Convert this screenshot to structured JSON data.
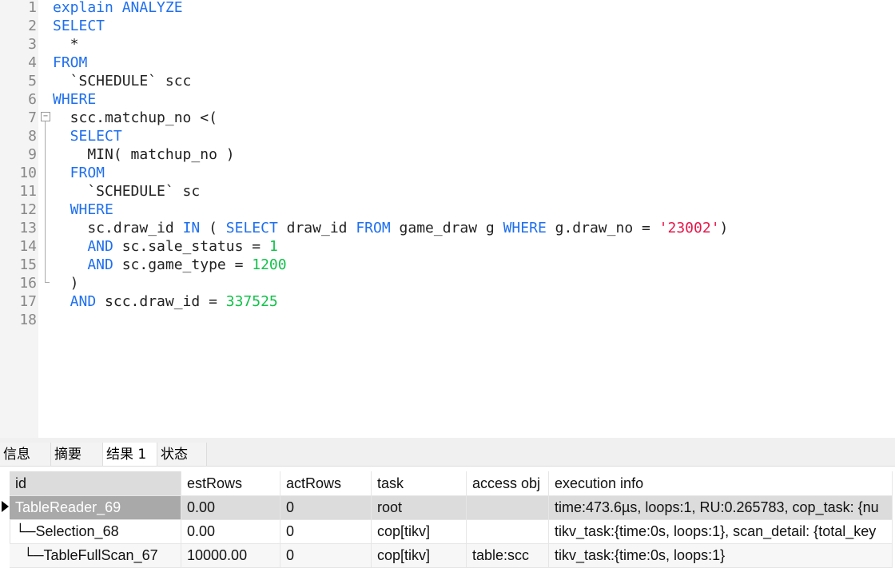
{
  "editor": {
    "lines": [
      [
        [
          "kw",
          "explain ANALYZE"
        ]
      ],
      [
        [
          "kw",
          "SELECT"
        ]
      ],
      [
        [
          "",
          "  *"
        ]
      ],
      [
        [
          "kw",
          "FROM"
        ]
      ],
      [
        [
          "",
          "  `SCHEDULE` scc"
        ]
      ],
      [
        [
          "kw",
          "WHERE"
        ]
      ],
      [
        [
          "",
          "  scc.matchup_no <("
        ]
      ],
      [
        [
          "kw",
          "  SELECT"
        ]
      ],
      [
        [
          "",
          "    MIN( matchup_no )"
        ]
      ],
      [
        [
          "kw",
          "  FROM"
        ]
      ],
      [
        [
          "",
          "    `SCHEDULE` sc"
        ]
      ],
      [
        [
          "kw",
          "  WHERE"
        ]
      ],
      [
        [
          "",
          "    sc.draw_id "
        ],
        [
          "kw",
          "IN"
        ],
        [
          "",
          " ( "
        ],
        [
          "kw",
          "SELECT"
        ],
        [
          "",
          " draw_id "
        ],
        [
          "kw",
          "FROM"
        ],
        [
          "",
          " game_draw g "
        ],
        [
          "kw",
          "WHERE"
        ],
        [
          "",
          " g.draw_no = "
        ],
        [
          "str",
          "'23002'"
        ],
        [
          "",
          ")"
        ]
      ],
      [
        [
          "kw",
          "    AND"
        ],
        [
          "",
          " sc.sale_status = "
        ],
        [
          "num",
          "1"
        ]
      ],
      [
        [
          "kw",
          "    AND"
        ],
        [
          "",
          " sc.game_type = "
        ],
        [
          "num",
          "1200"
        ]
      ],
      [
        [
          "",
          "  )"
        ]
      ],
      [
        [
          "kw",
          "  AND"
        ],
        [
          "",
          " scc.draw_id = "
        ],
        [
          "num",
          "337525"
        ]
      ],
      [
        [
          "",
          ""
        ]
      ]
    ]
  },
  "tabs": [
    "信息",
    "摘要",
    "结果 1",
    "状态"
  ],
  "active_tab": 2,
  "results": {
    "columns": [
      "id",
      "estRows",
      "actRows",
      "task",
      "access obj",
      "execution info"
    ],
    "rows": [
      [
        "TableReader_69",
        "0.00",
        "0",
        "root",
        "",
        "time:473.6µs, loops:1, RU:0.265783, cop_task: {nu"
      ],
      [
        "└─Selection_68",
        "0.00",
        "0",
        "cop[tikv]",
        "",
        "tikv_task:{time:0s, loops:1}, scan_detail: {total_key"
      ],
      [
        "  └─TableFullScan_67",
        "10000.00",
        "0",
        "cop[tikv]",
        "table:scc",
        "tikv_task:{time:0s, loops:1}"
      ]
    ]
  }
}
